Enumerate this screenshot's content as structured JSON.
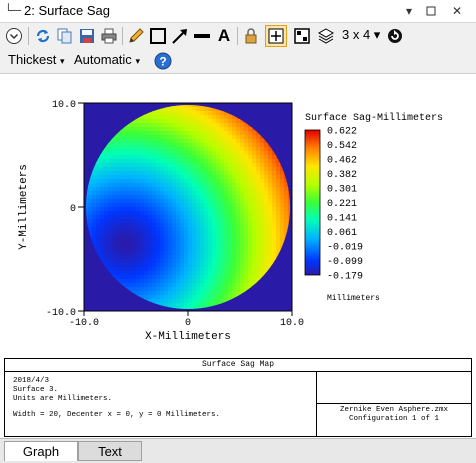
{
  "window": {
    "title": "2: Surface Sag"
  },
  "toolbar": {
    "grid_label": "3 x 4",
    "line_thickness": "Thickest",
    "scale_mode": "Automatic"
  },
  "chart_data": {
    "type": "heatmap",
    "title": "",
    "xlabel": "X-Millimeters",
    "ylabel": "Y-Millimeters",
    "xlim": [
      -10.0,
      10.0
    ],
    "ylim": [
      -10.0,
      10.0
    ],
    "x_ticks": [
      "-10.0",
      "0",
      "10.0"
    ],
    "y_ticks": [
      "10.0",
      "0",
      "-10.0"
    ],
    "colorbar": {
      "title": "Surface Sag-Millimeters",
      "unit": "Millimeters",
      "ticks": [
        "0.622",
        "0.542",
        "0.462",
        "0.382",
        "0.301",
        "0.221",
        "0.141",
        "0.061",
        "-0.019",
        "-0.099",
        "-0.179"
      ],
      "min": -0.179,
      "max": 0.622
    },
    "aperture_diameter": 20,
    "min_location": [
      -6.0,
      -3.5
    ],
    "max_location": [
      6.0,
      9.5
    ]
  },
  "info": {
    "title": "Surface Sag Map",
    "lines": [
      "2018/4/3",
      "Surface 3.",
      "Units are Millimeters.",
      "Width = 20, Decenter x = 0, y = 0 Millimeters."
    ],
    "file": "Zernike Even Asphere.zmx",
    "config": "Configuration 1 of 1"
  },
  "tabs": [
    "Graph",
    "Text"
  ]
}
